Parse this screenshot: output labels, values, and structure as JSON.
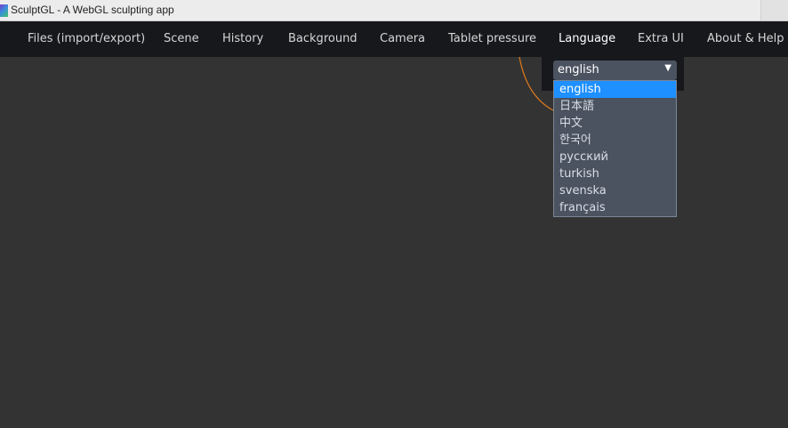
{
  "window": {
    "title": "SculptGL - A WebGL sculpting app"
  },
  "menu": {
    "items": [
      {
        "label": "Files (import/export)"
      },
      {
        "label": "Scene"
      },
      {
        "label": "History"
      },
      {
        "label": "Background"
      },
      {
        "label": "Camera"
      },
      {
        "label": "Tablet pressure"
      },
      {
        "label": "Language"
      },
      {
        "label": "Extra UI"
      },
      {
        "label": "About & Help"
      }
    ],
    "active": "Language"
  },
  "language": {
    "selected": "english",
    "arrow_icon": "triangle-down-icon",
    "options": [
      {
        "label": "english",
        "selected": true
      },
      {
        "label": "日本語"
      },
      {
        "label": "中文"
      },
      {
        "label": "한국어"
      },
      {
        "label": "русский"
      },
      {
        "label": "turkish"
      },
      {
        "label": "svenska"
      },
      {
        "label": "français"
      }
    ]
  },
  "colors": {
    "menubar_bg": "#17181b",
    "canvas_bg": "#333333",
    "select_bg": "#4b5360",
    "highlight": "#1e90ff",
    "cursor_ring": "#e07a1a"
  }
}
